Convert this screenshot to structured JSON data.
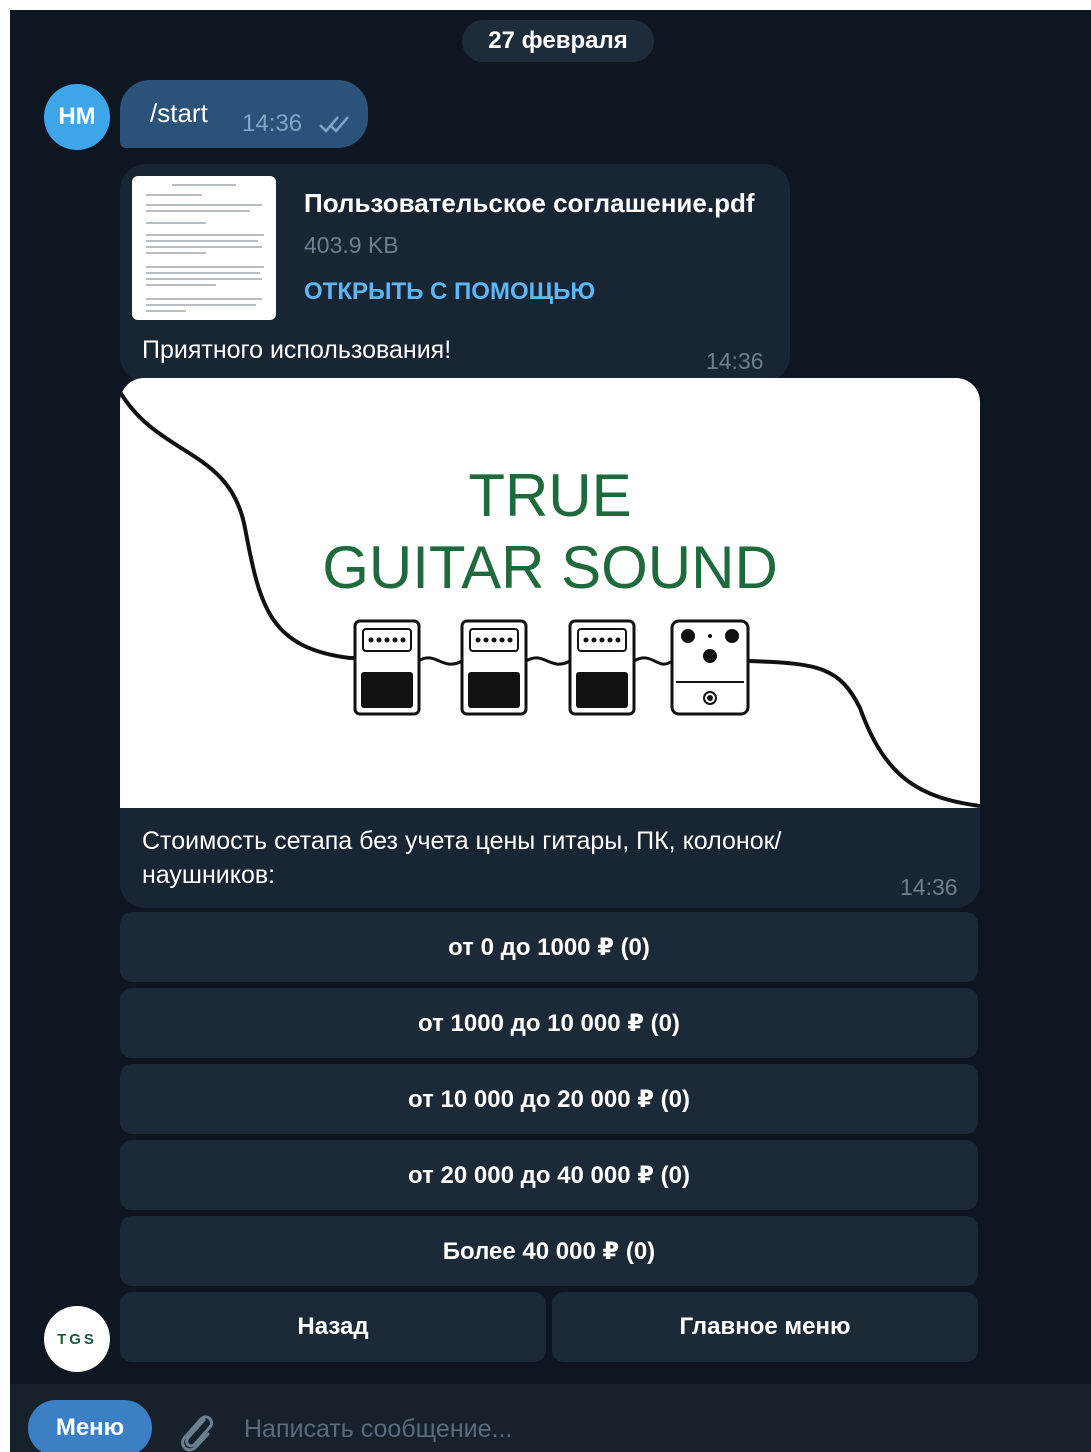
{
  "date_label": "27 февраля",
  "user": {
    "avatar_initials": "НМ"
  },
  "bot": {
    "avatar_text": "TGS"
  },
  "outgoing_message": {
    "text": "/start",
    "time": "14:36",
    "status_icon": "double-check-icon"
  },
  "document_message": {
    "file_name": "Пользовательское соглашение.pdf",
    "file_size": "403.9 KB",
    "open_with": "ОТКРЫТЬ С ПОМОЩЬЮ",
    "caption": "Приятного использования!",
    "time": "14:36"
  },
  "image_message": {
    "logo_line1": "TRUE",
    "logo_line2": "GUITAR SOUND",
    "caption": "Стоимость сетапа без учета цены гитары, ПК, колонок/ наушников:",
    "time": "14:36"
  },
  "keyboard": {
    "options": [
      "от 0 до 1000 ₽ (0)",
      "от 1000 до 10 000 ₽ (0)",
      "от 10 000 до 20 000 ₽ (0)",
      "от 20 000 до 40 000 ₽ (0)",
      "Более 40 000 ₽ (0)"
    ],
    "back": "Назад",
    "main_menu": "Главное меню"
  },
  "composer": {
    "menu_label": "Меню",
    "placeholder": "Написать сообщение..."
  },
  "colors": {
    "chat_bg": "#0e1621",
    "outgoing_bubble": "#2b5278",
    "incoming_bubble": "#182533",
    "keyboard_button": "#1c2a38",
    "link": "#5eb5f7",
    "logo_green": "#1f6a3c"
  }
}
